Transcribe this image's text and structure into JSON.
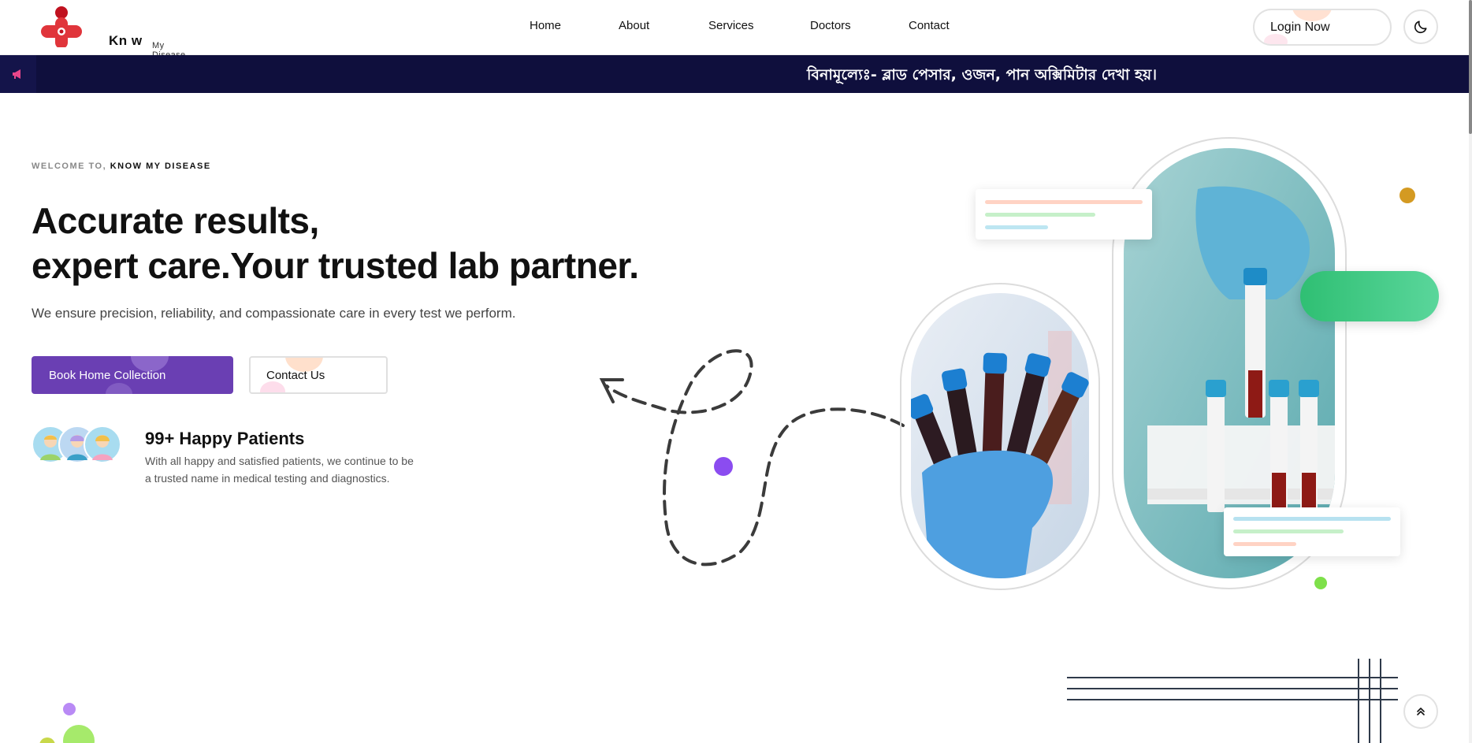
{
  "brand": {
    "logo_word": "Kn w",
    "logo_sub": "My Disease"
  },
  "nav": {
    "items": [
      {
        "label": "Home"
      },
      {
        "label": "About"
      },
      {
        "label": "Services"
      },
      {
        "label": "Doctors"
      },
      {
        "label": "Contact"
      }
    ],
    "login_label": "Login Now"
  },
  "notice": {
    "text": "বিনামূল্যেঃ- ব্লাড পেসার, ওজন, পান অক্সিমিটার দেখা হয়।"
  },
  "hero": {
    "welcome_prefix": "WELCOME TO,",
    "welcome_brand": "KNOW MY DISEASE",
    "title_line1": "Accurate results,",
    "title_line2": "expert care.Your trusted lab partner.",
    "description": "We ensure precision, reliability, and compassionate care in every test we perform.",
    "primary_button": "Book Home Collection",
    "secondary_button": "Contact Us",
    "patients_title": "99+ Happy Patients",
    "patients_desc": "With all happy and satisfied patients, we continue to be a trusted name in medical testing and diagnostics."
  },
  "colors": {
    "accent_purple": "#6a3fb3",
    "notice_bg": "#0f0f3d",
    "logo_red": "#e0353b",
    "pill_green": "#2fbf73"
  },
  "icons": [
    "megaphone-icon",
    "moon-icon",
    "chevrons-up-icon"
  ]
}
